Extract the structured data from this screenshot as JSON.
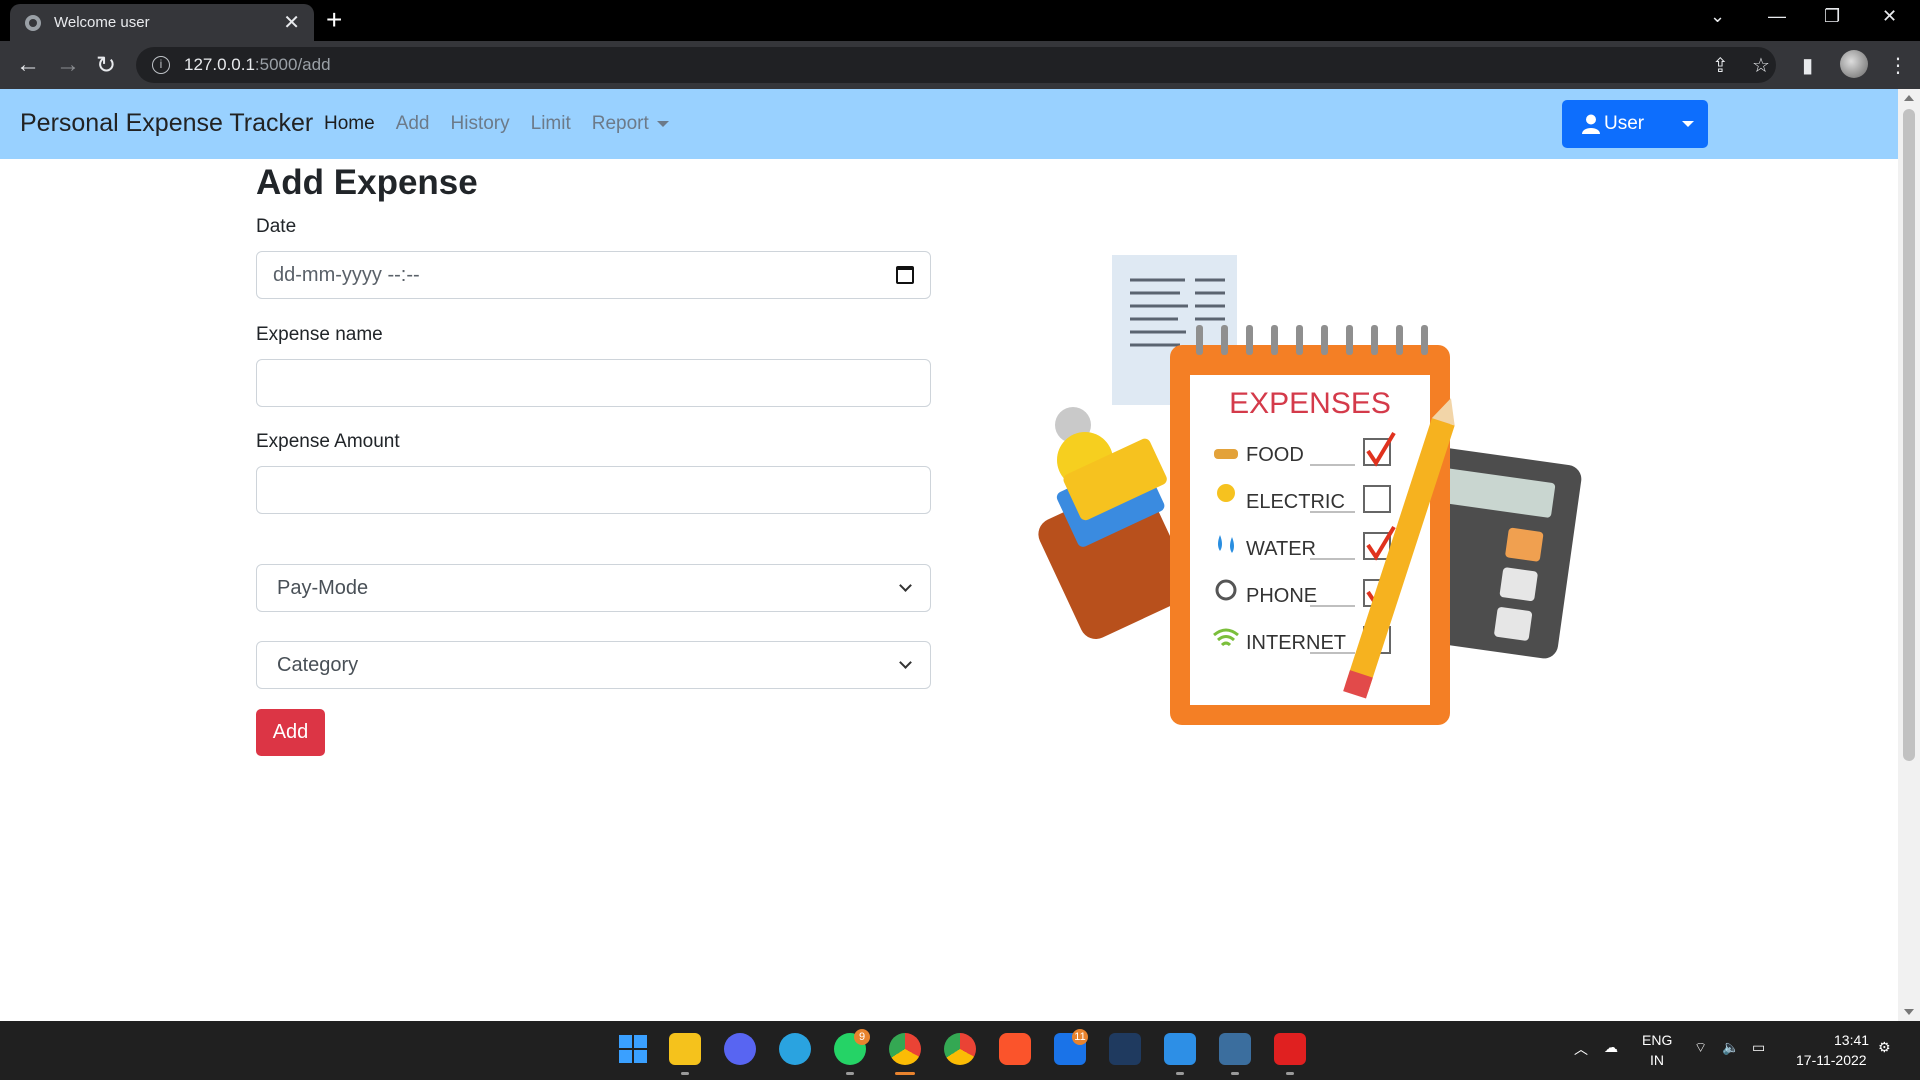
{
  "browser": {
    "tab_title": "Welcome user",
    "url_host": "127.0.0.1",
    "url_path": ":5000/add"
  },
  "navbar": {
    "brand": "Personal Expense Tracker",
    "links": [
      "Home",
      "Add",
      "History",
      "Limit"
    ],
    "report": "Report",
    "user_button": "User"
  },
  "form": {
    "title": "Add Expense",
    "date_label": "Date",
    "date_placeholder": "dd-mm-yyyy --:--",
    "name_label": "Expense name",
    "amount_label": "Expense Amount",
    "paymode_selected": "Pay-Mode",
    "category_selected": "Category",
    "submit": "Add"
  },
  "illustration": {
    "heading": "EXPENSES",
    "items": [
      "FOOD",
      "ELECTRIC",
      "WATER",
      "PHONE",
      "INTERNET"
    ],
    "checked": [
      true,
      false,
      true,
      true,
      false
    ]
  },
  "taskbar": {
    "whatsapp_badge": "9",
    "mail_badge": "11",
    "lang": "ENG",
    "region": "IN",
    "time": "13:41",
    "date": "17-11-2022"
  },
  "colors": {
    "navbar_bg": "#99d1ff",
    "primary": "#0d6efd",
    "danger": "#dc3545"
  }
}
